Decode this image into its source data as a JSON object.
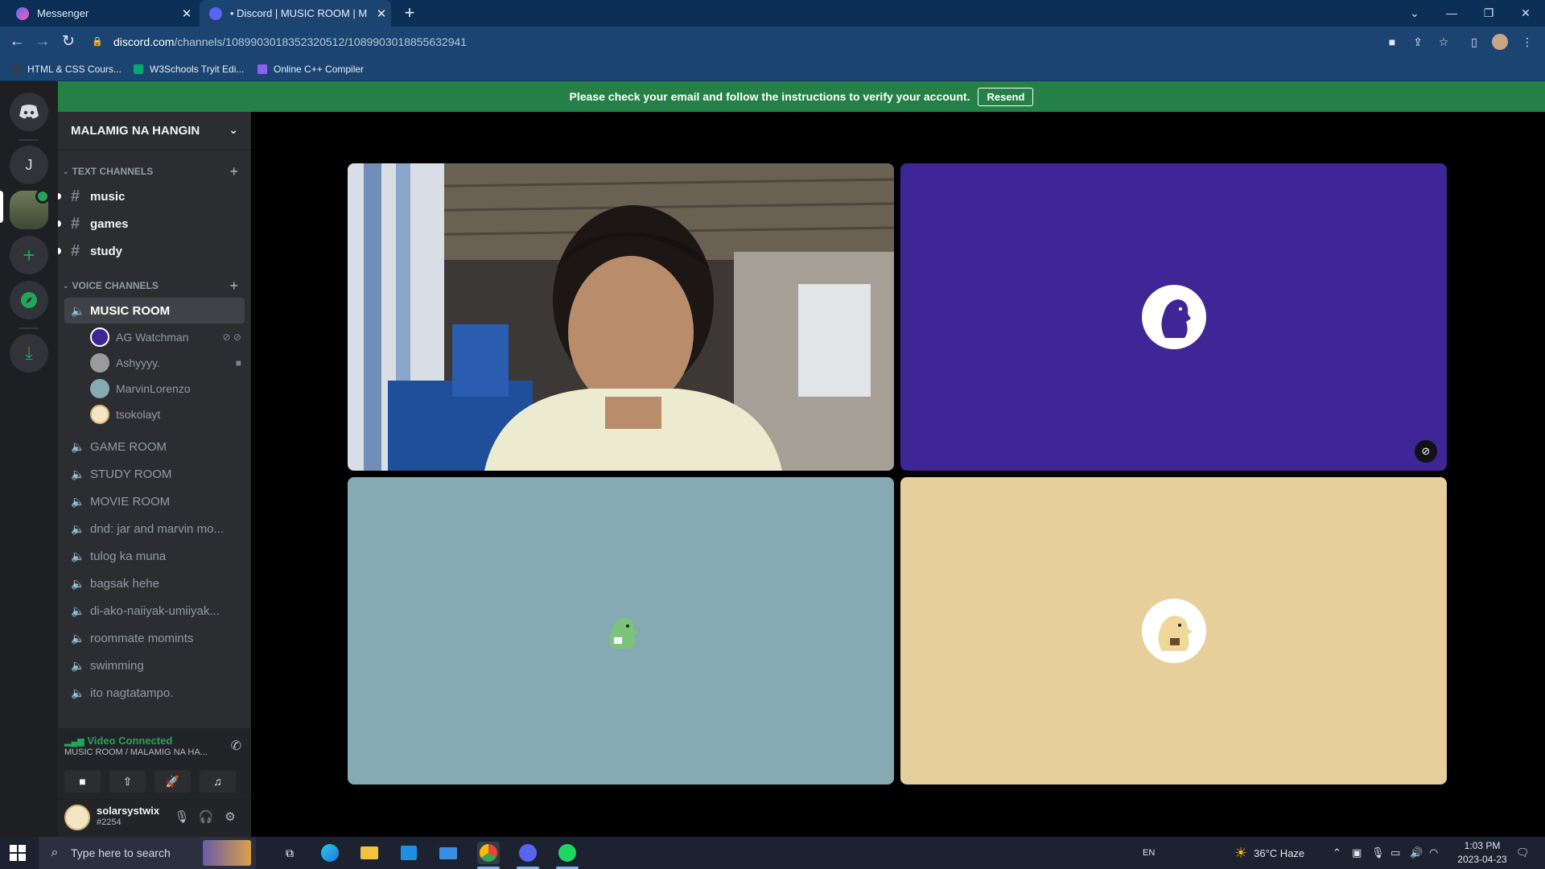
{
  "browser": {
    "tabs": [
      {
        "title": "Messenger",
        "active": false
      },
      {
        "title": "• Discord | MUSIC ROOM | M",
        "active": true
      }
    ],
    "url_host": "discord.com",
    "url_path": "/channels/1089903018352320512/1089903018855632941",
    "bookmarks": [
      "HTML & CSS Cours...",
      "W3Schools Tryit Edi...",
      "Online C++ Compiler"
    ]
  },
  "discord": {
    "verify_banner": {
      "message": "Please check your email and follow the instructions to verify your account.",
      "button": "Resend"
    },
    "guild_letter": "J",
    "server_name": "MALAMIG NA HANGIN",
    "text_category": "TEXT CHANNELS",
    "text_channels": [
      "music",
      "games",
      "study"
    ],
    "voice_category": "VOICE CHANNELS",
    "voice_channels": [
      "MUSIC ROOM",
      "GAME ROOM",
      "STUDY ROOM",
      "MOVIE ROOM",
      "dnd: jar and marvin mo...",
      "tulog ka muna",
      "bagsak hehe",
      "di-ako-naiiyak-umiiyak...",
      "roommate momints",
      "swimming",
      "ito nagtatampo."
    ],
    "voice_users": [
      "AG Watchman",
      "Ashyyyy.",
      "MarvinLorenzo",
      "tsokolayt"
    ],
    "voice_status": {
      "title": "Video Connected",
      "subtitle": "MUSIC ROOM / MALAMIG NA HA..."
    },
    "user": {
      "name": "solarsystwix",
      "tag": "#2254"
    },
    "tile_colors": [
      "#2b2b2b",
      "#3f2696",
      "#86aab4",
      "#e6cf9a"
    ]
  },
  "taskbar": {
    "search_placeholder": "Type here to search",
    "language": "EN",
    "weather": "36°C  Haze",
    "time": "1:03 PM",
    "date": "2023-04-23"
  }
}
